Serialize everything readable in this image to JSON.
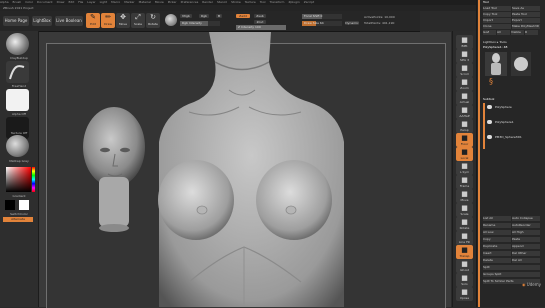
{
  "menubar": {
    "items": [
      "Alpha",
      "Brush",
      "Color",
      "Document",
      "Draw",
      "Edit",
      "File",
      "Layer",
      "Light",
      "Macro",
      "Marker",
      "Material",
      "Movie",
      "Picker",
      "Preferences",
      "Render",
      "Stencil",
      "Stroke",
      "Texture",
      "Tool",
      "Transform",
      "Zplugin",
      "Zscript"
    ],
    "right_text": ""
  },
  "infobar": {
    "text": "ZBrush 2021 Project"
  },
  "shelf": {
    "home_page": "Home Page",
    "lightbox": "LightBox",
    "live_boolean": "Live Boolean",
    "edit": "Edit",
    "draw": "Draw",
    "move": "Move",
    "scale": "Scale",
    "rotate": "Rotate",
    "mrgb": "Mrgb",
    "rgb": "Rgb",
    "m": "M",
    "zadd": "Zadd",
    "zsub": "Zsub",
    "zcut": "Zcut",
    "rgb_intensity": "Rgb Intensity",
    "z_intensity": "Z Intensity 100",
    "focal_shift": "Focal Shift 0",
    "draw_size": "Draw Size 64",
    "dynamic": "Dynamic",
    "active_points": "ActivePoints: 10,000",
    "total_points": "TotalPoints: 491,190"
  },
  "left_shelf": {
    "brush_label": "ClayBuildup",
    "stroke_label": "FreeHand",
    "alpha_label": "Alpha Off",
    "texture_label": "Texture Off",
    "material_label": "MatCap Gray",
    "gradient_label": "Gradient",
    "switch_label": "SwitchColor",
    "alternate_label": "Alternate"
  },
  "right_shelf": {
    "items": [
      {
        "label": "BPR",
        "icon": "bpr-icon"
      },
      {
        "label": "SPix 3",
        "icon": "spix-icon"
      },
      {
        "label": "Scroll",
        "icon": "scroll-icon"
      },
      {
        "label": "Zoom",
        "icon": "zoom-icon"
      },
      {
        "label": "Actual",
        "icon": "actual-icon"
      },
      {
        "label": "AAHalf",
        "icon": "aahalf-icon"
      },
      {
        "label": "Persp",
        "icon": "persp-icon"
      },
      {
        "label": "Floor",
        "icon": "floor-icon"
      },
      {
        "label": "Local",
        "icon": "local-icon"
      },
      {
        "label": "L.Sym",
        "icon": "lsym-icon"
      },
      {
        "label": "Frame",
        "icon": "frame-icon"
      },
      {
        "label": "Move",
        "icon": "move-icon"
      },
      {
        "label": "Scale",
        "icon": "scale-icon"
      },
      {
        "label": "Rotate",
        "icon": "rotate-icon"
      },
      {
        "label": "Line Fill",
        "icon": "linefill-icon"
      },
      {
        "label": "Transp",
        "icon": "transp-icon"
      },
      {
        "label": "Ghost",
        "icon": "ghost-icon"
      },
      {
        "label": "Solo",
        "icon": "solo-icon"
      },
      {
        "label": "Xpose",
        "icon": "xpose-icon"
      }
    ]
  },
  "tray": {
    "title": "Tool",
    "buttons": [
      [
        "Load Tool",
        "Save As"
      ],
      [
        "Copy Tool",
        "Paste Tool"
      ],
      [
        "Import",
        "Export"
      ],
      [
        "Clone",
        "Make PolyMesh3D"
      ],
      [
        "GoZ",
        "All",
        "Visible",
        "R"
      ]
    ],
    "lightbox_tools": "Lightbox ▸ Tools",
    "tool_name": "PolySphere1: 48",
    "subtool_header": "Subtool",
    "subtools": [
      "PolySphere",
      "PolySphere1",
      "PM3D_Sphere3D1"
    ],
    "rows": [
      [
        "List All",
        "Auto Collapse"
      ],
      [
        "Rename",
        "AutoReorder"
      ],
      [
        "All Low",
        "All High"
      ],
      [
        "Copy",
        "Paste"
      ],
      [
        "Duplicate",
        "Append"
      ],
      [
        "Insert",
        "Del Other"
      ],
      [
        "Delete",
        "Del All"
      ],
      [
        "Split"
      ],
      [
        "Groups Split"
      ],
      [
        "Split To Similar Parts"
      ]
    ],
    "watermark": "Udemy"
  },
  "colors": {
    "accent": "#e2833a",
    "panel": "#262626",
    "canvas": "#3a3a3a"
  }
}
